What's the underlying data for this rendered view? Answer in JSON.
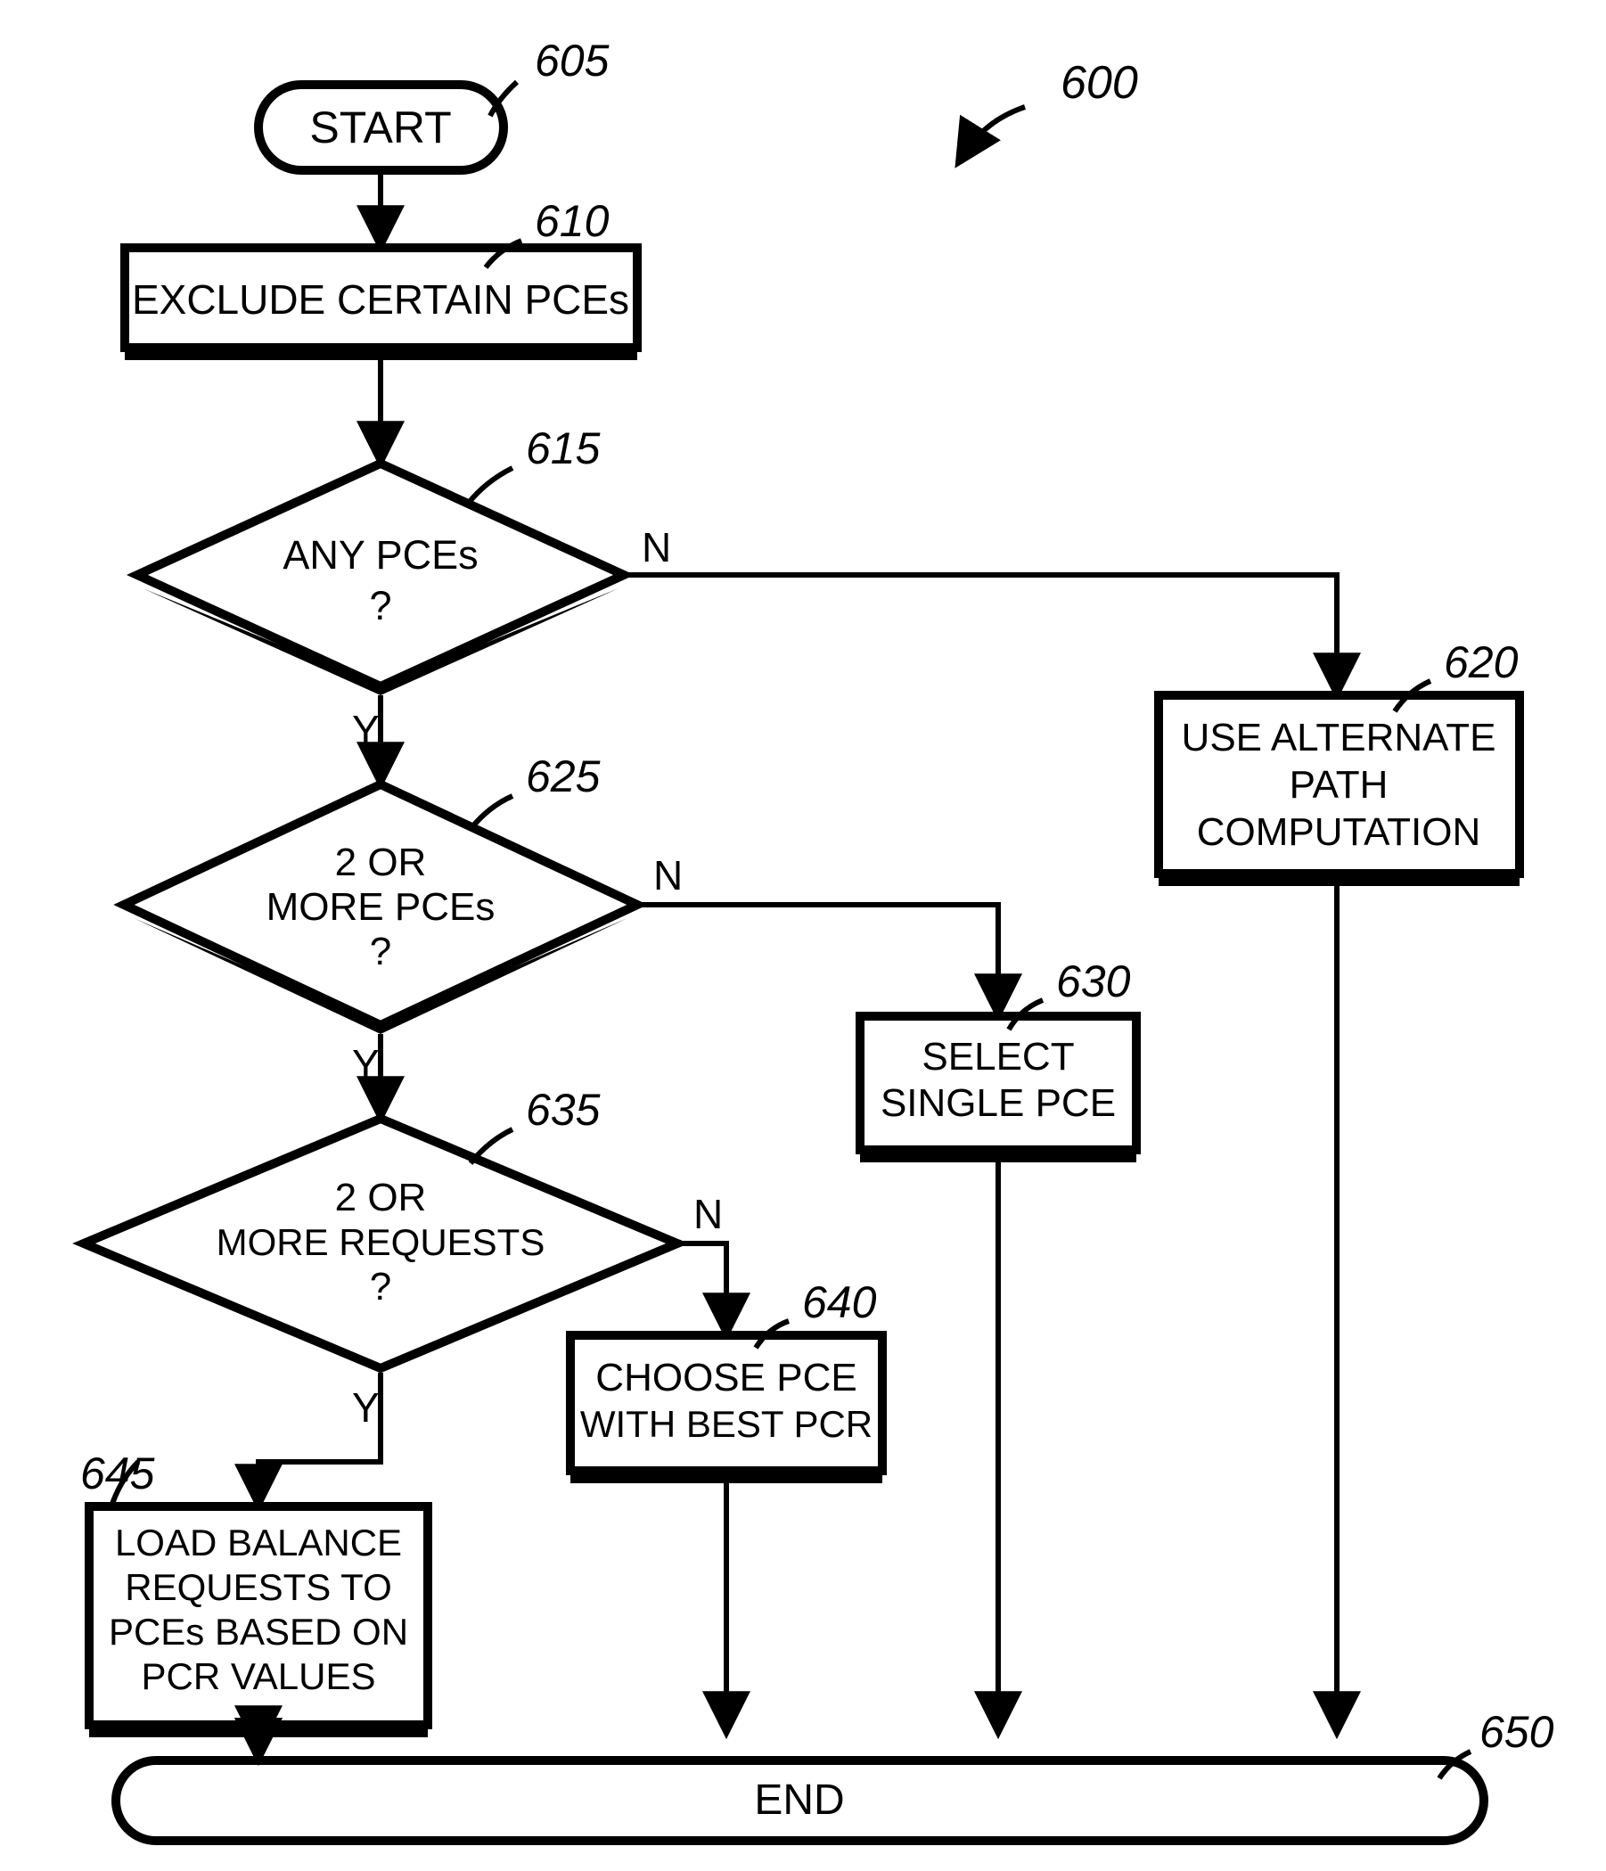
{
  "chart_data": {
    "type": "flowchart",
    "figure_ref": "600",
    "nodes": [
      {
        "id": "start",
        "ref": "605",
        "kind": "terminator",
        "text": [
          "START"
        ]
      },
      {
        "id": "exclude",
        "ref": "610",
        "kind": "process",
        "text": [
          "EXCLUDE CERTAIN PCEs"
        ]
      },
      {
        "id": "any",
        "ref": "615",
        "kind": "decision",
        "text": [
          "ANY PCEs",
          "?"
        ]
      },
      {
        "id": "alt",
        "ref": "620",
        "kind": "process",
        "text": [
          "USE ALTERNATE",
          "PATH",
          "COMPUTATION"
        ]
      },
      {
        "id": "two_pce",
        "ref": "625",
        "kind": "decision",
        "text": [
          "2 OR",
          "MORE PCEs",
          "?"
        ]
      },
      {
        "id": "single",
        "ref": "630",
        "kind": "process",
        "text": [
          "SELECT",
          "SINGLE PCE"
        ]
      },
      {
        "id": "two_req",
        "ref": "635",
        "kind": "decision",
        "text": [
          "2 OR",
          "MORE REQUESTS",
          "?"
        ]
      },
      {
        "id": "best",
        "ref": "640",
        "kind": "process",
        "text": [
          "CHOOSE PCE",
          "WITH BEST PCR"
        ]
      },
      {
        "id": "load",
        "ref": "645",
        "kind": "process",
        "text": [
          "LOAD BALANCE",
          "REQUESTS TO",
          "PCEs BASED ON",
          "PCR VALUES"
        ]
      },
      {
        "id": "end",
        "ref": "650",
        "kind": "terminator",
        "text": [
          "END"
        ]
      }
    ],
    "edges": [
      {
        "from": "start",
        "to": "exclude"
      },
      {
        "from": "exclude",
        "to": "any"
      },
      {
        "from": "any",
        "to": "two_pce",
        "label": "Y"
      },
      {
        "from": "any",
        "to": "alt",
        "label": "N"
      },
      {
        "from": "two_pce",
        "to": "two_req",
        "label": "Y"
      },
      {
        "from": "two_pce",
        "to": "single",
        "label": "N"
      },
      {
        "from": "two_req",
        "to": "load",
        "label": "Y"
      },
      {
        "from": "two_req",
        "to": "best",
        "label": "N"
      },
      {
        "from": "alt",
        "to": "end"
      },
      {
        "from": "single",
        "to": "end"
      },
      {
        "from": "best",
        "to": "end"
      },
      {
        "from": "load",
        "to": "end"
      }
    ],
    "labels": {
      "yes": "Y",
      "no": "N"
    }
  }
}
